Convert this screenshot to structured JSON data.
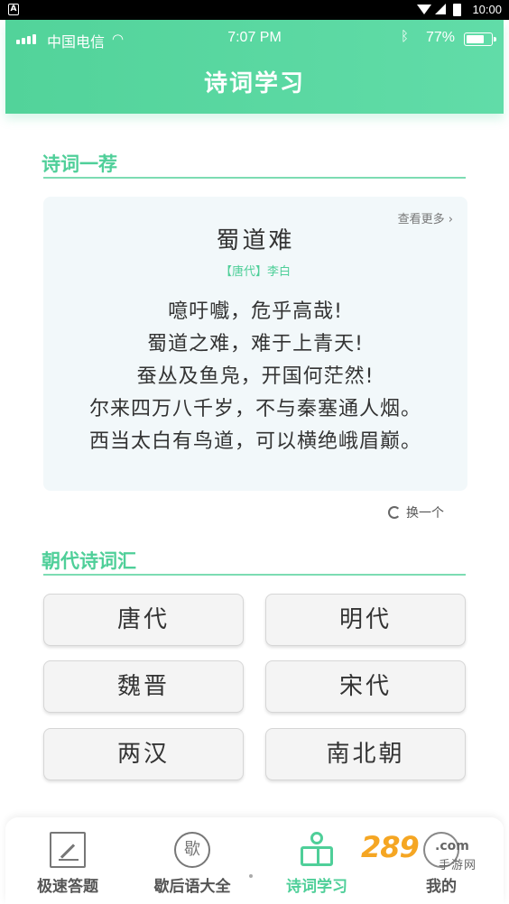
{
  "android_status": {
    "badge": "A",
    "time": "10:00"
  },
  "ios_status": {
    "carrier": "中国电信",
    "time": "7:07 PM",
    "battery": "77%",
    "battery_level": 0.77,
    "wifi_icon": "wifi-icon",
    "bluetooth_icon": "bluetooth-icon"
  },
  "header": {
    "title": "诗词学习"
  },
  "recommend": {
    "section_title": "诗词一荐",
    "more_label": "查看更多 ›",
    "poem": {
      "title": "蜀道难",
      "author": "【唐代】李白",
      "lines": [
        "噫吁嚱，危乎高哉!",
        "蜀道之难，难于上青天!",
        "蚕丛及鱼凫，开国何茫然!",
        "尔来四万八千岁，不与秦塞通人烟。",
        "西当太白有鸟道，可以横绝峨眉巅。"
      ]
    },
    "refresh_label": "换一个"
  },
  "dynasties": {
    "section_title": "朝代诗词汇",
    "items": [
      "唐代",
      "明代",
      "魏晋",
      "宋代",
      "两汉",
      "南北朝"
    ]
  },
  "tabbar": {
    "tabs": [
      {
        "label": "极速答题",
        "icon": "pencil-square-icon",
        "active": false
      },
      {
        "label": "歇后语大全",
        "icon": "xie-circle-icon",
        "active": false
      },
      {
        "label": "诗词学习",
        "icon": "reading-person-icon",
        "active": true
      },
      {
        "label": "我的",
        "icon": "person-icon",
        "active": false
      }
    ]
  },
  "watermark": {
    "brand": "289",
    "domain": ".com",
    "subtitle": "手游网"
  },
  "colors": {
    "accent": "#4fcf99",
    "header": "#5cd9a3",
    "card": "#f2f8fa"
  }
}
